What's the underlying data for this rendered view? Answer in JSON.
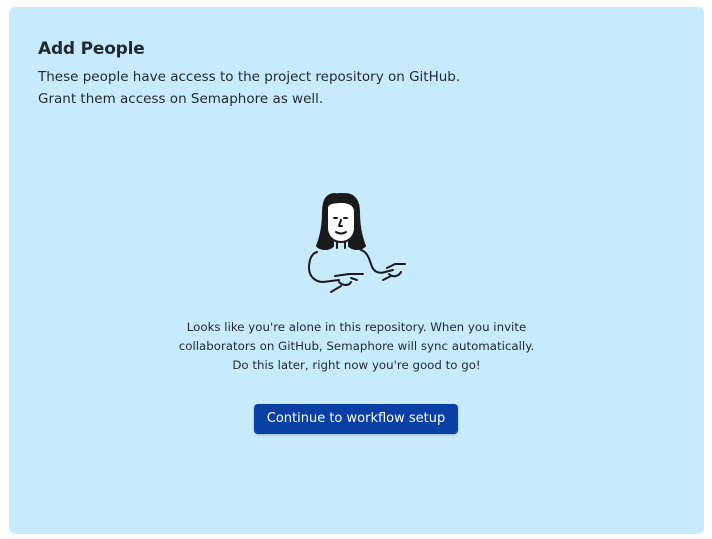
{
  "panel": {
    "title": "Add People",
    "description_line1": "These people have access to the project repository on GitHub.",
    "description_line2": "Grant them access on Semaphore as well."
  },
  "empty_state": {
    "illustration_icon": "person-pointing-icon",
    "message_line1": "Looks like you're alone in this repository. When you invite",
    "message_line2": "collaborators on GitHub, Semaphore will sync automatically.",
    "message_line3": "Do this later, right now you're good to go!"
  },
  "actions": {
    "continue_label": "Continue to workflow setup"
  },
  "colors": {
    "panel_background": "#c7ebfc",
    "primary_button": "#0a3fa6",
    "text": "#1f2a30"
  }
}
